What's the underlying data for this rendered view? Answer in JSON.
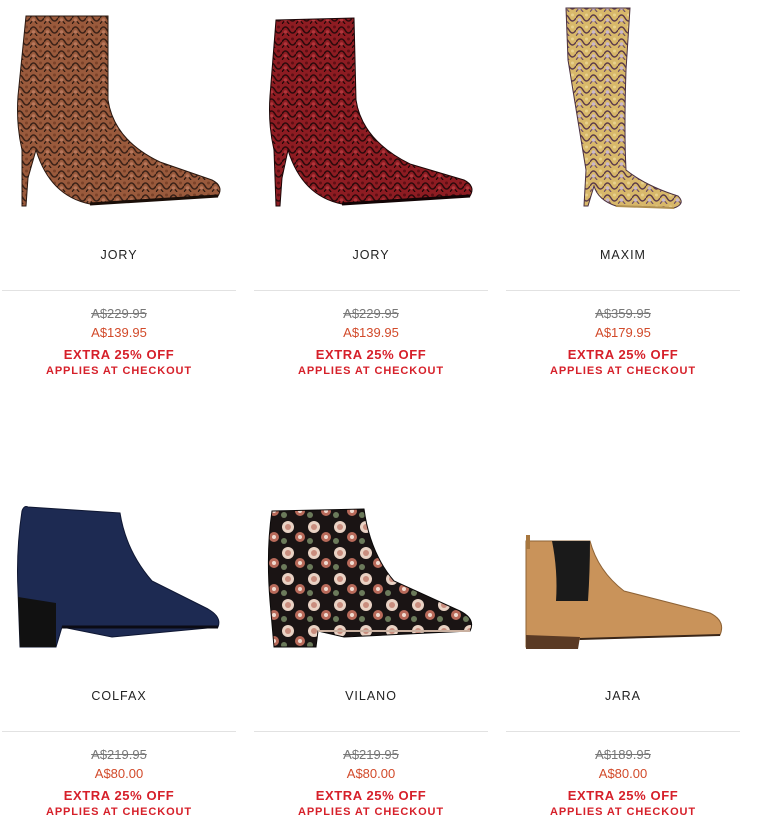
{
  "products": [
    {
      "name": "JORY",
      "was_price": "A$229.95",
      "price": "A$139.95",
      "promo": "EXTRA 25% OFF",
      "promo_note": "APPLIES AT CHECKOUT"
    },
    {
      "name": "JORY",
      "was_price": "A$229.95",
      "price": "A$139.95",
      "promo": "EXTRA 25% OFF",
      "promo_note": "APPLIES AT CHECKOUT"
    },
    {
      "name": "MAXIM",
      "was_price": "A$359.95",
      "price": "A$179.95",
      "promo": "EXTRA 25% OFF",
      "promo_note": "APPLIES AT CHECKOUT"
    },
    {
      "name": "COLFAX",
      "was_price": "A$219.95",
      "price": "A$80.00",
      "promo": "EXTRA 25% OFF",
      "promo_note": "APPLIES AT CHECKOUT"
    },
    {
      "name": "VILANO",
      "was_price": "A$219.95",
      "price": "A$80.00",
      "promo": "EXTRA 25% OFF",
      "promo_note": "APPLIES AT CHECKOUT"
    },
    {
      "name": "JARA",
      "was_price": "A$189.95",
      "price": "A$80.00",
      "promo": "EXTRA 25% OFF",
      "promo_note": "APPLIES AT CHECKOUT"
    }
  ],
  "colors": {
    "price_sale": "#d24a2a",
    "promo_red": "#d6202a",
    "was_price": "#777777"
  }
}
